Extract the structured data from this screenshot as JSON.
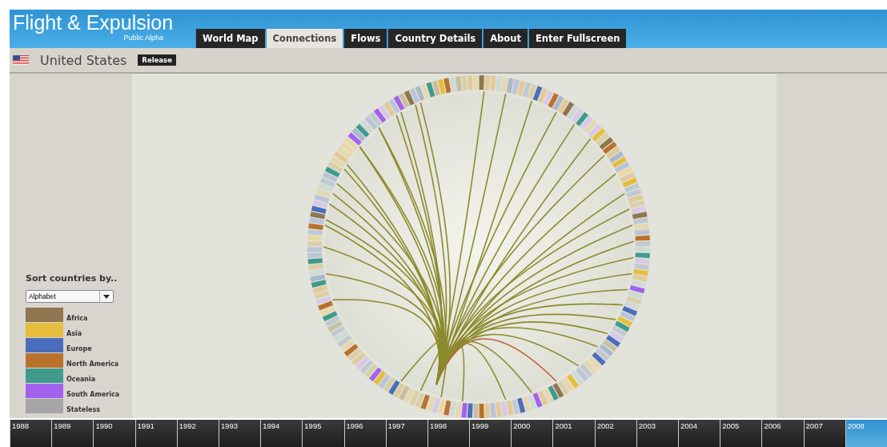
{
  "app": {
    "title": "Flight & Expulsion",
    "subtitle": "Public Alpha"
  },
  "tabs": [
    {
      "label": "World Map",
      "selected": false
    },
    {
      "label": "Connections",
      "selected": true
    },
    {
      "label": "Flows",
      "selected": false
    },
    {
      "label": "Country Details",
      "selected": false
    },
    {
      "label": "About",
      "selected": false
    },
    {
      "label": "Enter Fullscreen",
      "selected": false
    }
  ],
  "country": {
    "name": "United States",
    "badge": "Release"
  },
  "sort": {
    "label": "Sort countries by..",
    "value": "Alphabet"
  },
  "legend": [
    {
      "label": "Africa",
      "color": "#8f7650"
    },
    {
      "label": "Asia",
      "color": "#e6bd3c"
    },
    {
      "label": "Europe",
      "color": "#4a6ebd"
    },
    {
      "label": "North America",
      "color": "#b8722c"
    },
    {
      "label": "Oceania",
      "color": "#3f9c8c"
    },
    {
      "label": "South America",
      "color": "#a262ee"
    },
    {
      "label": "Stateless",
      "color": "#a6a6a6"
    }
  ],
  "timeline": [
    {
      "year": "1988",
      "selected": false
    },
    {
      "year": "1989",
      "selected": false
    },
    {
      "year": "1990",
      "selected": false
    },
    {
      "year": "1991",
      "selected": false
    },
    {
      "year": "1992",
      "selected": false
    },
    {
      "year": "1993",
      "selected": false
    },
    {
      "year": "1994",
      "selected": false
    },
    {
      "year": "1995",
      "selected": false
    },
    {
      "year": "1996",
      "selected": false
    },
    {
      "year": "1997",
      "selected": false
    },
    {
      "year": "1998",
      "selected": false
    },
    {
      "year": "1999",
      "selected": false
    },
    {
      "year": "2000",
      "selected": false
    },
    {
      "year": "2001",
      "selected": false
    },
    {
      "year": "2002",
      "selected": false
    },
    {
      "year": "2003",
      "selected": false
    },
    {
      "year": "2004",
      "selected": false
    },
    {
      "year": "2005",
      "selected": false
    },
    {
      "year": "2006",
      "selected": false
    },
    {
      "year": "2007",
      "selected": false
    },
    {
      "year": "2008",
      "selected": true
    }
  ]
}
